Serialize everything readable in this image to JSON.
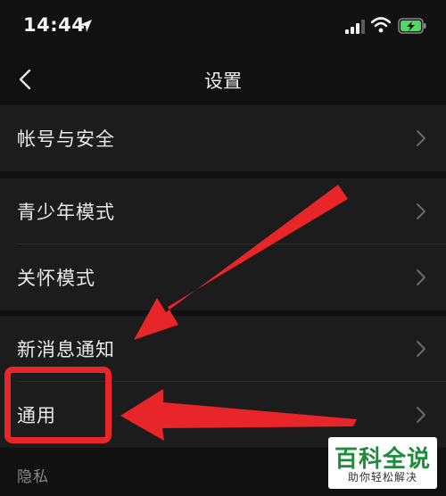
{
  "status_bar": {
    "time": "14:44"
  },
  "nav": {
    "title": "设置"
  },
  "groups": [
    {
      "items": [
        {
          "label": "帐号与安全"
        }
      ]
    },
    {
      "items": [
        {
          "label": "青少年模式"
        },
        {
          "label": "关怀模式"
        }
      ]
    },
    {
      "items": [
        {
          "label": "新消息通知"
        },
        {
          "label": "通用"
        }
      ]
    }
  ],
  "section": {
    "label": "隐私"
  },
  "watermark": {
    "main": "百科全说",
    "sub": "助你轻松解决"
  },
  "colors": {
    "background": "#111111",
    "row": "#1c1c1c",
    "annotation": "#e8262a",
    "battery": "#4cd964",
    "watermark_text": "#1f8a3c"
  },
  "icons": [
    "location-arrow-icon",
    "signal-icon",
    "wifi-icon",
    "battery-charging-icon",
    "back-chevron-icon",
    "chevron-right-icon"
  ]
}
